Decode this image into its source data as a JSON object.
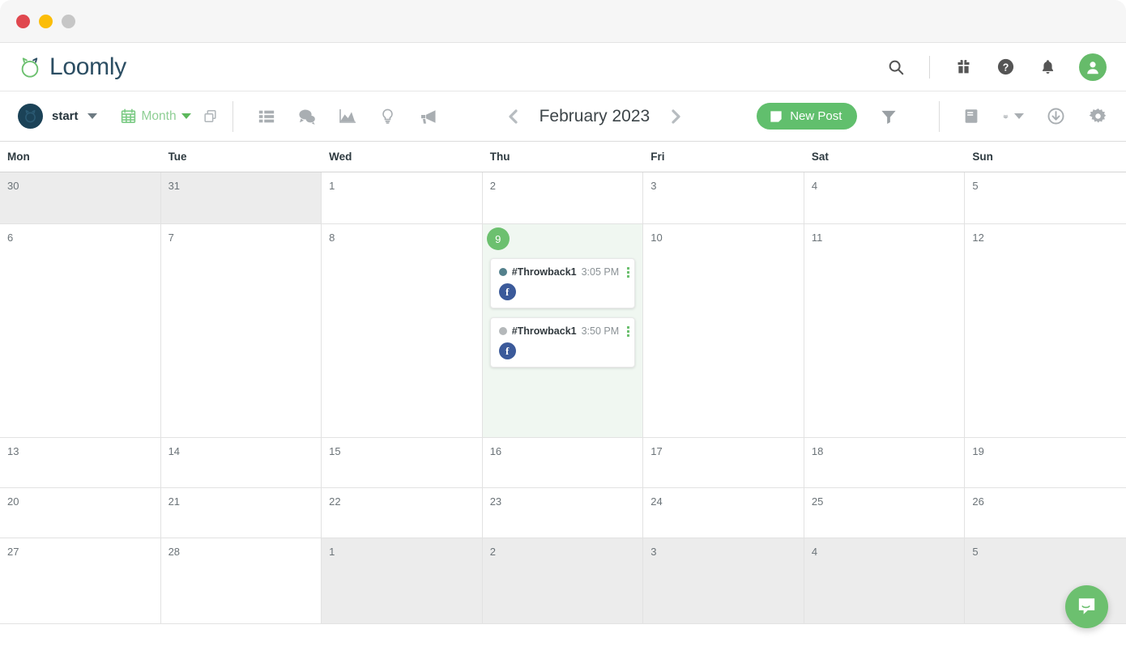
{
  "window": {
    "traffic_lights": [
      "close",
      "minimize",
      "maximize"
    ]
  },
  "header": {
    "brand_name": "Loomly",
    "icons": [
      {
        "name": "search-icon",
        "label": "Search"
      },
      {
        "name": "gift-icon",
        "label": "What's new"
      },
      {
        "name": "help-icon",
        "label": "Help"
      },
      {
        "name": "bell-icon",
        "label": "Notifications"
      },
      {
        "name": "avatar",
        "label": "Account"
      }
    ]
  },
  "toolbar": {
    "calendar_name": "start",
    "view_label": "Month",
    "duplicate_label": "Duplicate",
    "view_icons": [
      {
        "name": "list-view-icon",
        "label": "List"
      },
      {
        "name": "comments-icon",
        "label": "Comments"
      },
      {
        "name": "analytics-icon",
        "label": "Analytics"
      },
      {
        "name": "ideas-icon",
        "label": "Post Ideas"
      },
      {
        "name": "ads-icon",
        "label": "Ads"
      }
    ],
    "prev_label": "Previous month",
    "next_label": "Next month",
    "month_label": "February 2023",
    "new_post_label": "New Post",
    "filter_label": "Filter",
    "right_icons": [
      {
        "name": "library-icon",
        "label": "Library"
      },
      {
        "name": "team-icon",
        "label": "Team"
      },
      {
        "name": "export-icon",
        "label": "Export"
      },
      {
        "name": "settings-icon",
        "label": "Settings"
      }
    ]
  },
  "calendar": {
    "weekdays": [
      "Mon",
      "Tue",
      "Wed",
      "Thu",
      "Fri",
      "Sat",
      "Sun"
    ],
    "weeks": [
      [
        {
          "day": "30",
          "muted": true,
          "today": false,
          "posts": []
        },
        {
          "day": "31",
          "muted": true,
          "today": false,
          "posts": []
        },
        {
          "day": "1",
          "muted": false,
          "today": false,
          "posts": []
        },
        {
          "day": "2",
          "muted": false,
          "today": false,
          "posts": []
        },
        {
          "day": "3",
          "muted": false,
          "today": false,
          "posts": []
        },
        {
          "day": "4",
          "muted": false,
          "today": false,
          "posts": []
        },
        {
          "day": "5",
          "muted": false,
          "today": false,
          "posts": []
        }
      ],
      [
        {
          "day": "6",
          "muted": false,
          "today": false,
          "posts": []
        },
        {
          "day": "7",
          "muted": false,
          "today": false,
          "posts": []
        },
        {
          "day": "8",
          "muted": false,
          "today": false,
          "posts": []
        },
        {
          "day": "9",
          "muted": false,
          "today": true,
          "posts": [
            {
              "title": "#Throwback1",
              "time": "3:05 PM",
              "state_color": "#53808c",
              "channels": [
                "facebook"
              ]
            },
            {
              "title": "#Throwback1",
              "time": "3:50 PM",
              "state_color": "#b4b8ba",
              "channels": [
                "facebook"
              ]
            }
          ]
        },
        {
          "day": "10",
          "muted": false,
          "today": false,
          "posts": []
        },
        {
          "day": "11",
          "muted": false,
          "today": false,
          "posts": []
        },
        {
          "day": "12",
          "muted": false,
          "today": false,
          "posts": []
        }
      ],
      [
        {
          "day": "13",
          "muted": false,
          "today": false,
          "posts": []
        },
        {
          "day": "14",
          "muted": false,
          "today": false,
          "posts": []
        },
        {
          "day": "15",
          "muted": false,
          "today": false,
          "posts": []
        },
        {
          "day": "16",
          "muted": false,
          "today": false,
          "posts": []
        },
        {
          "day": "17",
          "muted": false,
          "today": false,
          "posts": []
        },
        {
          "day": "18",
          "muted": false,
          "today": false,
          "posts": []
        },
        {
          "day": "19",
          "muted": false,
          "today": false,
          "posts": []
        }
      ],
      [
        {
          "day": "20",
          "muted": false,
          "today": false,
          "posts": []
        },
        {
          "day": "21",
          "muted": false,
          "today": false,
          "posts": []
        },
        {
          "day": "22",
          "muted": false,
          "today": false,
          "posts": []
        },
        {
          "day": "23",
          "muted": false,
          "today": false,
          "posts": []
        },
        {
          "day": "24",
          "muted": false,
          "today": false,
          "posts": []
        },
        {
          "day": "25",
          "muted": false,
          "today": false,
          "posts": []
        },
        {
          "day": "26",
          "muted": false,
          "today": false,
          "posts": []
        }
      ],
      [
        {
          "day": "27",
          "muted": false,
          "today": false,
          "posts": []
        },
        {
          "day": "28",
          "muted": false,
          "today": false,
          "posts": []
        },
        {
          "day": "1",
          "muted": true,
          "today": false,
          "posts": []
        },
        {
          "day": "2",
          "muted": true,
          "today": false,
          "posts": []
        },
        {
          "day": "3",
          "muted": true,
          "today": false,
          "posts": []
        },
        {
          "day": "4",
          "muted": true,
          "today": false,
          "posts": []
        },
        {
          "day": "5",
          "muted": true,
          "today": false,
          "posts": []
        }
      ]
    ]
  },
  "support": {
    "chat_label": "Open chat"
  },
  "colors": {
    "brand_green": "#6cc06f",
    "brand_navy": "#2c4e63",
    "button_green": "#61bf6d",
    "facebook_blue": "#3b5a9a",
    "today_bg": "#f0f7f1",
    "muted_bg": "#ececec"
  }
}
